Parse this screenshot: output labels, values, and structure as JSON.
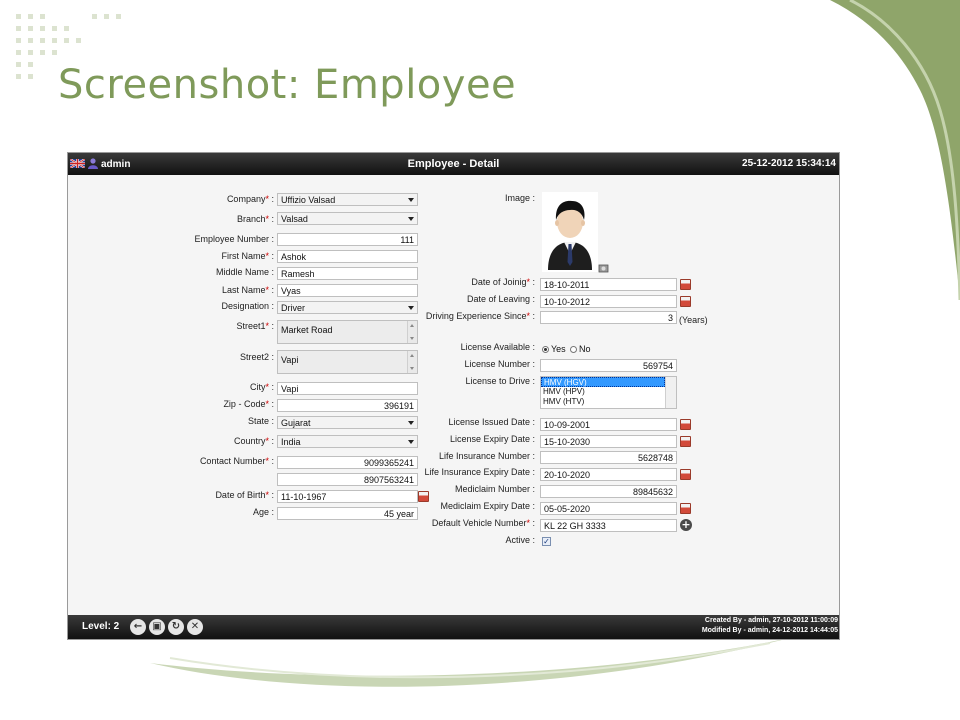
{
  "slide": {
    "title": "Screenshot: Employee"
  },
  "topbar": {
    "user": "admin",
    "title": "Employee - Detail",
    "datetime": "25-12-2012 15:34:14"
  },
  "form_left": {
    "company": {
      "label": "Company",
      "value": "Uffizio Valsad"
    },
    "branch": {
      "label": "Branch",
      "value": "Valsad"
    },
    "employee_number": {
      "label": "Employee Number :",
      "value": "111"
    },
    "first_name": {
      "label": "First Name",
      "value": "Ashok"
    },
    "middle_name": {
      "label": "Middle Name :",
      "value": "Ramesh"
    },
    "last_name": {
      "label": "Last Name",
      "value": "Vyas"
    },
    "designation": {
      "label": "Designation :",
      "value": "Driver"
    },
    "street1": {
      "label": "Street1",
      "value": "Market Road"
    },
    "street2": {
      "label": "Street2 :",
      "value": "Vapi"
    },
    "city": {
      "label": "City",
      "value": "Vapi"
    },
    "zip": {
      "label": "Zip - Code",
      "value": "396191"
    },
    "state": {
      "label": "State :",
      "value": "Gujarat"
    },
    "country": {
      "label": "Country",
      "value": "India"
    },
    "contact": {
      "label": "Contact Number",
      "value1": "9099365241",
      "value2": "8907563241"
    },
    "dob": {
      "label": "Date of Birth",
      "value": "11-10-1967"
    },
    "age": {
      "label": "Age :",
      "value": "45 year"
    }
  },
  "form_right": {
    "image": {
      "label": "Image :"
    },
    "date_joining": {
      "label": "Date of Joinig",
      "value": "18-10-2011"
    },
    "date_leaving": {
      "label": "Date of Leaving :",
      "value": "10-10-2012"
    },
    "driving_exp": {
      "label": "Driving Experience Since",
      "value": "3",
      "unit": "(Years)"
    },
    "license_available": {
      "label": "License Available :",
      "yes": "Yes",
      "no": "No"
    },
    "license_number": {
      "label": "License Number :",
      "value": "569754"
    },
    "license_to_drive": {
      "label": "License to Drive :",
      "options": [
        "HMV (HGV)",
        "HMV (HPV)",
        "HMV (HTV)"
      ]
    },
    "license_issued": {
      "label": "License Issued Date :",
      "value": "10-09-2001"
    },
    "license_expiry": {
      "label": "License Expiry Date :",
      "value": "15-10-2030"
    },
    "life_ins_number": {
      "label": "Life Insurance Number :",
      "value": "5628748"
    },
    "life_ins_expiry": {
      "label": "Life Insurance Expiry Date :",
      "value": "20-10-2020"
    },
    "mediclaim_number": {
      "label": "Mediclaim Number :",
      "value": "89845632"
    },
    "mediclaim_expiry": {
      "label": "Mediclaim Expiry Date :",
      "value": "05-05-2020"
    },
    "default_vehicle": {
      "label": "Default Vehicle Number",
      "value": "KL 22 GH 3333"
    },
    "active": {
      "label": "Active :",
      "check": "✓"
    }
  },
  "footer": {
    "level": "Level: 2",
    "created": "Created By - admin, 27-10-2012 11:00:09",
    "modified": "Modified By - admin, 24-12-2012 14:44:05"
  },
  "colors": {
    "title_green": "#7f9a5a",
    "bar_dark": "#1a1a1a",
    "required_red": "#cc0000",
    "selected_blue": "#3399ff"
  },
  "icons": [
    "flag-icon",
    "user-icon",
    "calendar-icon",
    "add-icon",
    "back-icon",
    "save-icon",
    "refresh-icon",
    "close-icon",
    "image-edit-icon"
  ]
}
